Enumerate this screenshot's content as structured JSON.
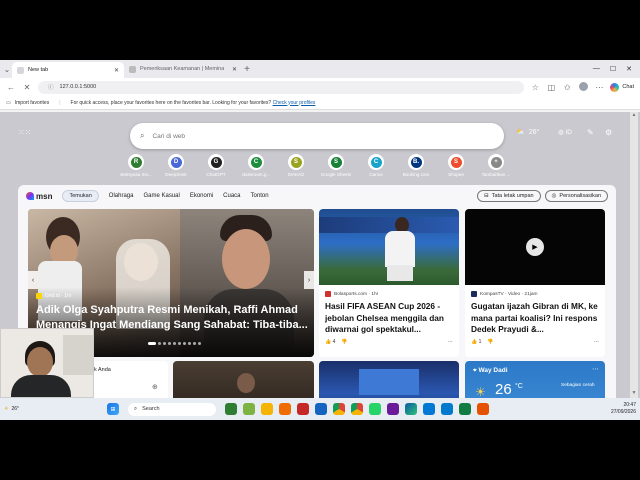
{
  "tabs": [
    {
      "label": "New tab",
      "active": true
    },
    {
      "label": "Pemeriksaan Keamanan | Memina",
      "active": false
    }
  ],
  "browser": {
    "url": "127.0.0.1:5000",
    "chat_label": "Chat"
  },
  "favbar": {
    "import_label": "Import favorites",
    "hint": "For quick access, place your favorites here on the favorites bar. Looking for your favorites?",
    "link": "Check your profiles"
  },
  "search": {
    "placeholder": "Cari di web"
  },
  "weather": {
    "temp": "26°"
  },
  "region": {
    "label": "ID"
  },
  "quick_links": [
    {
      "label": "Beksyasa Ins...",
      "letter": "R",
      "color": "#2e7d32"
    },
    {
      "label": "DeepSeek",
      "letter": "D",
      "color": "#4a68d8"
    },
    {
      "label": "ChatGPT",
      "letter": "G",
      "color": "#222222"
    },
    {
      "label": "classroom.g...",
      "letter": "C",
      "color": "#1e8e3e"
    },
    {
      "label": "SIAKAD",
      "letter": "S",
      "color": "#9aa420"
    },
    {
      "label": "Google Sheets",
      "letter": "S",
      "color": "#188038"
    },
    {
      "label": "Canva",
      "letter": "C",
      "color": "#1aa3c9"
    },
    {
      "label": "Booking.com",
      "letter": "B.",
      "color": "#003580"
    },
    {
      "label": "Shopee",
      "letter": "S",
      "color": "#ee4d2d"
    },
    {
      "label": "Tambahkan ...",
      "letter": "+",
      "color": "#888888"
    }
  ],
  "feed_nav": {
    "brand": "msn",
    "tabs": [
      "Temukan",
      "Olahraga",
      "Game Kasual",
      "Ekonomi",
      "Cuaca",
      "Tonton"
    ],
    "layout_btn": "Tata letak umpan",
    "personalize_btn": "Personalisasikan"
  },
  "hero": {
    "source": "Grid.id · 1hr",
    "title": "Adik Olga Syahputra Resmi Menikah, Raffi Ahmad Menangis Ingat Mendiang Sang Sahabat: Tiba-tiba..."
  },
  "cards": [
    {
      "source": "Bolasports.com · 1hr",
      "title": "Hasil FIFA ASEAN Cup 2026 - jebolan Chelsea menggila dan diwarnai gol spektakul...",
      "likes": "4"
    },
    {
      "source": "KompasTV · Video · 21jam",
      "title": "Gugatan ijazah Gibran di MK, ke mana partai koalisi? Ini respons Dedek Prayudi &...",
      "likes": "1"
    }
  ],
  "bottom": {
    "anda_label": "k Anda",
    "weather_place": "Way Dadi",
    "weather_temp": "26",
    "weather_desc": "Sebagian cerah"
  },
  "taskbar": {
    "weather": "26°",
    "search_label": "Search",
    "time": "20:47",
    "date": "27/09/2026"
  }
}
